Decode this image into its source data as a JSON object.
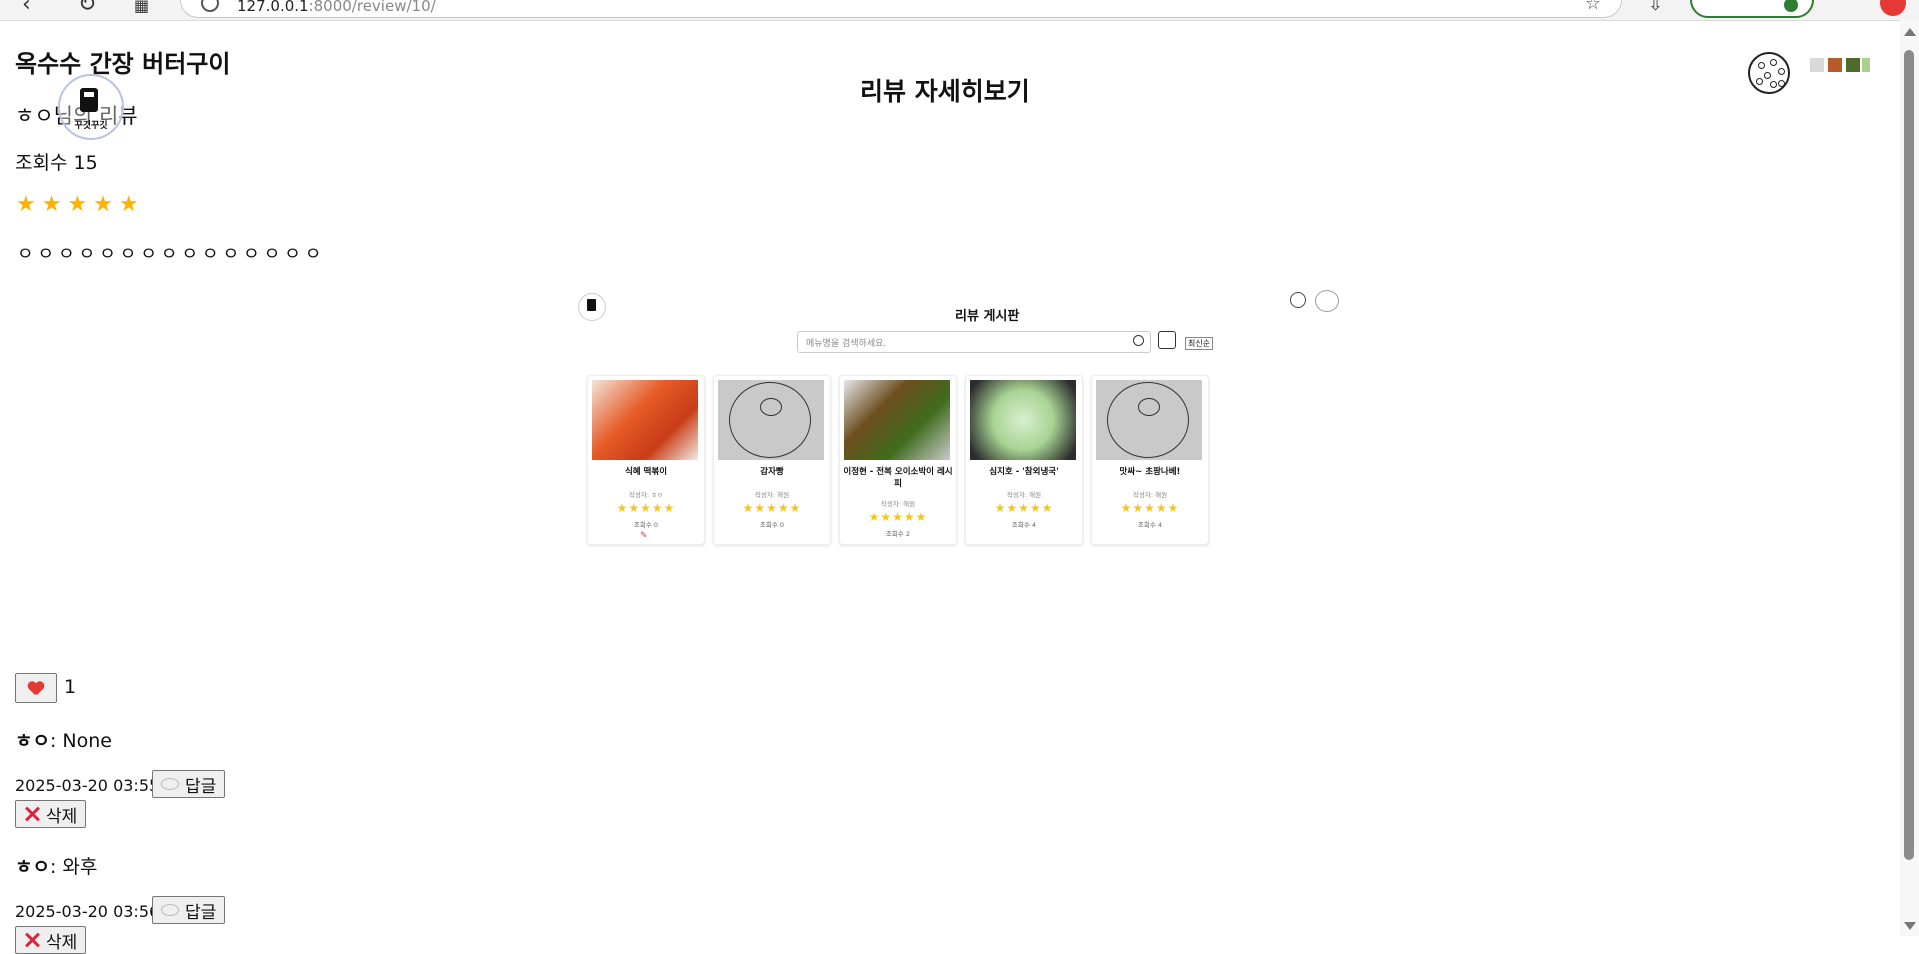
{
  "browser": {
    "url_host": "127.0.0.1",
    "url_rest": ":8000/review/10/"
  },
  "page": {
    "title": "옥수수 간장 버터구이",
    "heading": "리뷰 자세히보기",
    "reviewer_line": "ㅎㅇ님의 리뷰",
    "views": "조회수 15",
    "stars": "★★★★★",
    "rating": 5,
    "content": "ㅇㅇㅇㅇㅇㅇㅇㅇㅇㅇㅇㅇㅇㅇㅇ",
    "logo_text": "꾸깃꾸깃"
  },
  "embedded_screenshot": {
    "title": "리뷰 게시판",
    "search_placeholder": "메뉴명을 검색하세요.",
    "sort_option": "최신순",
    "cards": [
      {
        "name": "식혜 떡볶이",
        "author": "작성자: ㅎㅇ",
        "stars": "★★★★★",
        "views": "조회수 0"
      },
      {
        "name": "감자빵",
        "author": "작성자: 해원",
        "stars": "★★★★★",
        "views": "조회수 0"
      },
      {
        "name": "이정현 - 전복 오이소박이 레시피",
        "author": "작성자: 해원",
        "stars": "★★★★★",
        "views": "조회수 2"
      },
      {
        "name": "심지호 - '참외냉국'",
        "author": "작성자: 해원",
        "stars": "★★★★★",
        "views": "조회수 4"
      },
      {
        "name": "맛싸~ 초팡나베!",
        "author": "작성자: 해원",
        "stars": "★★★★★",
        "views": "조회수 4"
      }
    ]
  },
  "likes": {
    "count": "1"
  },
  "comments": [
    {
      "author": "ㅎㅇ",
      "text": ": None",
      "date": "2025-03-20 03:55",
      "reply_label": "답글",
      "delete_label": "삭제"
    },
    {
      "author": "ㅎㅇ",
      "text": ": 와후",
      "date": "2025-03-20 03:56",
      "reply_label": "답글",
      "delete_label": "삭제"
    }
  ],
  "colors": {
    "star": "#ffb300",
    "heart": "#e53935",
    "delete_x": "#d7263d"
  }
}
